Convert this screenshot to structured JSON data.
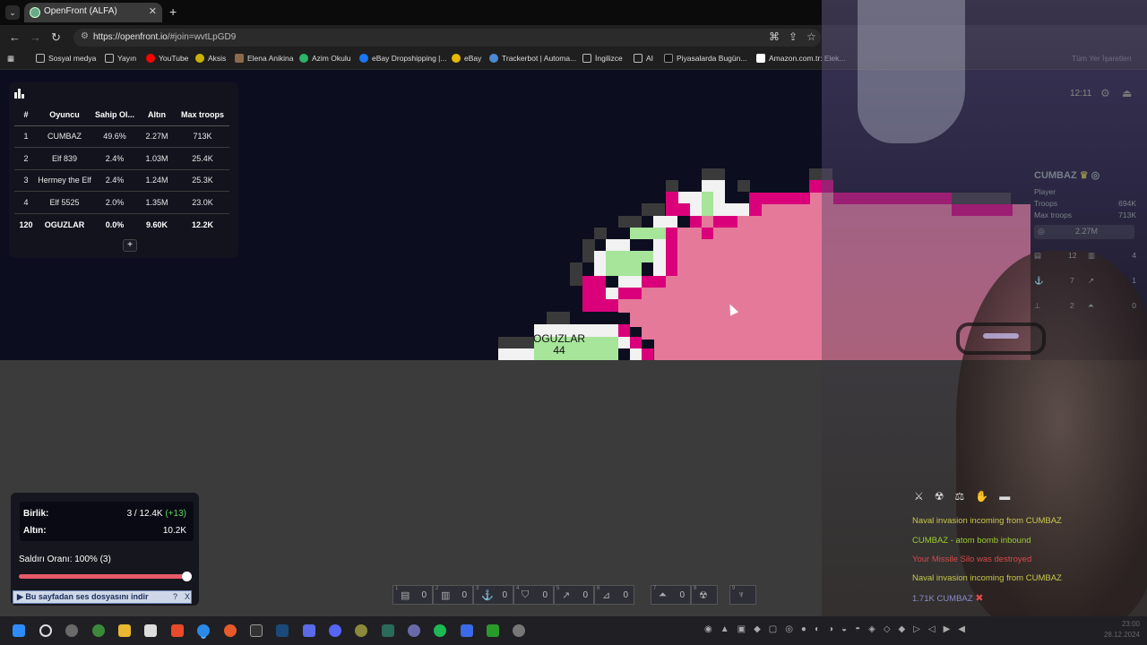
{
  "browser": {
    "tab_title": "OpenFront (ALFA)",
    "url_host": "https://openfront.io",
    "url_path": "/#join=wvtLpGD9",
    "bookmarks": [
      {
        "label": "Sosyal medya",
        "icon": "folder-icon",
        "color": "#bbbbbb"
      },
      {
        "label": "Yayın",
        "icon": "folder-icon",
        "color": "#bbbbbb"
      },
      {
        "label": "YouTube",
        "icon": "youtube-icon",
        "color": "#ff0000"
      },
      {
        "label": "Aksis",
        "icon": "aksis-icon",
        "color": "#c8b400"
      },
      {
        "label": "Elena Anikina",
        "icon": "person-icon",
        "color": "#8a6a4a"
      },
      {
        "label": "Azim Okulu",
        "icon": "azim-icon",
        "color": "#2db36b"
      },
      {
        "label": "eBay Dropshipping |...",
        "icon": "facebook-icon",
        "color": "#1877f2"
      },
      {
        "label": "eBay",
        "icon": "ebay-icon",
        "color": "#e6b800"
      },
      {
        "label": "Trackerbot | Automa...",
        "icon": "tracker-icon",
        "color": "#4a8ad6"
      },
      {
        "label": "İngilizce",
        "icon": "folder-icon",
        "color": "#bbbbbb"
      },
      {
        "label": "AI",
        "icon": "folder-icon",
        "color": "#bbbbbb"
      },
      {
        "label": "Piyasalarda Bugün...",
        "icon": "tv-icon",
        "color": "#111111"
      },
      {
        "label": "Amazon.com.tr: Elek...",
        "icon": "amazon-icon",
        "color": "#ffffff"
      }
    ],
    "all_bookmarks": "Tüm Yer İşaretleri"
  },
  "leaderboard": {
    "headers": [
      "#",
      "Oyuncu",
      "Sahip Ol...",
      "Altın",
      "Max troops"
    ],
    "rows": [
      {
        "rank": "1",
        "name": "CUMBAZ",
        "owned": "49.6%",
        "gold": "2.27M",
        "troops": "713K"
      },
      {
        "rank": "2",
        "name": "Elf 839",
        "owned": "2.4%",
        "gold": "1.03M",
        "troops": "25.4K"
      },
      {
        "rank": "3",
        "name": "Hermey the Elf",
        "owned": "2.4%",
        "gold": "1.24M",
        "troops": "25.3K"
      },
      {
        "rank": "4",
        "name": "Elf 5525",
        "owned": "2.0%",
        "gold": "1.35M",
        "troops": "23.0K"
      },
      {
        "rank": "120",
        "name": "OGUZLAR",
        "owned": "0.0%",
        "gold": "9.60K",
        "troops": "12.2K"
      }
    ],
    "more_label": "+"
  },
  "map": {
    "player_label": "OGUZLAR",
    "player_troops": "44",
    "colors": {
      "enemy_fill": "#e5799a",
      "enemy_border": "#d9007a",
      "player_fill": "#a6e59a",
      "player_border": "#f2f2f2",
      "ocean": "#0d0d20"
    }
  },
  "clock": "12:11",
  "player_card": {
    "name": "CUMBAZ",
    "type": "Player",
    "troops_label": "Troops",
    "troops_value": "694K",
    "max_troops_label": "Max troops",
    "max_troops_value": "713K",
    "gold": "2.27M",
    "buildings": [
      {
        "icon": "city-icon",
        "value": "12"
      },
      {
        "icon": "factory-icon",
        "value": "4"
      },
      {
        "icon": "port-icon",
        "value": "7"
      },
      {
        "icon": "missile-icon",
        "value": "1"
      },
      {
        "icon": "defense-icon",
        "value": "2"
      },
      {
        "icon": "warship-icon",
        "value": "0"
      }
    ]
  },
  "stats": {
    "troops_label": "Birlik:",
    "troops_value": "3 / 12.4K",
    "troops_gain": "(+13)",
    "gold_label": "Altın:",
    "gold_value": "10.2K",
    "attack_ratio": "Saldırı Oranı: 100% (3)",
    "attack_ratio_value": 1.0
  },
  "download_bar": {
    "label": "Bu sayfadan ses dosyasını indir",
    "help": "?",
    "close": "X"
  },
  "build_bar": [
    {
      "key": "1",
      "icon": "city-icon",
      "count": "0"
    },
    {
      "key": "2",
      "icon": "factory-icon",
      "count": "0"
    },
    {
      "key": "3",
      "icon": "port-icon",
      "count": "0"
    },
    {
      "key": "4",
      "icon": "defense-post-icon",
      "count": "0"
    },
    {
      "key": "5",
      "icon": "missile-silo-icon",
      "count": "0"
    },
    {
      "key": "6",
      "icon": "sam-launcher-icon",
      "count": "0"
    },
    {
      "key": "7",
      "icon": "warship-icon",
      "count": "0"
    },
    {
      "key": "8",
      "icon": "atom-bomb-icon",
      "count": ""
    },
    {
      "key": "9",
      "icon": "hydrogen-bomb-icon",
      "count": ""
    }
  ],
  "event_log": {
    "tabs": [
      "sword-icon",
      "nuke-icon",
      "trade-icon",
      "alliance-icon",
      "chat-icon"
    ],
    "events": [
      {
        "text": "Naval invasion incoming from CUMBAZ",
        "color": "#c8c84a"
      },
      {
        "text": "CUMBAZ - atom bomb inbound",
        "color": "#9acd32"
      },
      {
        "text": "Your Missile Silo was destroyed",
        "color": "#d64a4a"
      },
      {
        "text": "Naval invasion incoming from CUMBAZ",
        "color": "#c8c84a"
      },
      {
        "text": "1.71K CUMBAZ",
        "color": "#8a8acc",
        "action": "✖"
      }
    ]
  },
  "taskbar": {
    "time": "23:00",
    "date": "28.12.2024"
  }
}
